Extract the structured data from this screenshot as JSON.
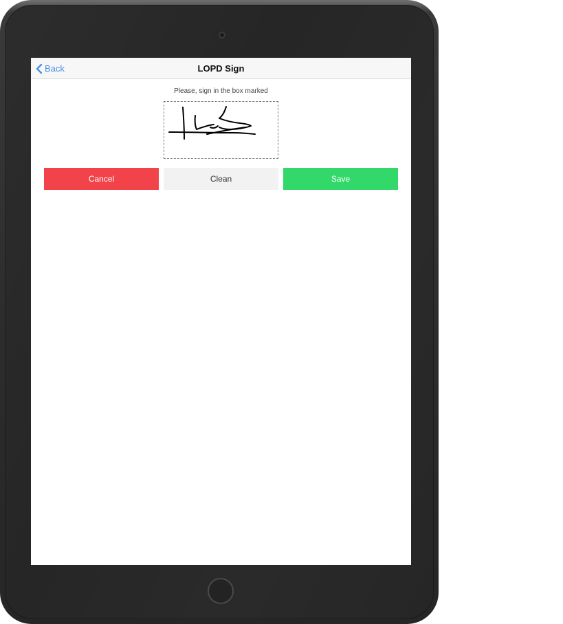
{
  "nav": {
    "back_label": "Back",
    "title": "LOPD Sign"
  },
  "signature": {
    "instruction": "Please, sign in the box marked"
  },
  "actions": {
    "cancel_label": "Cancel",
    "clean_label": "Clean",
    "save_label": "Save"
  },
  "colors": {
    "accent": "#4a90e2",
    "cancel": "#f2434a",
    "clean": "#f2f2f2",
    "save": "#32d86a"
  },
  "icons": {
    "back": "chevron-left-icon",
    "camera": "camera-icon",
    "home": "home-button-icon"
  }
}
